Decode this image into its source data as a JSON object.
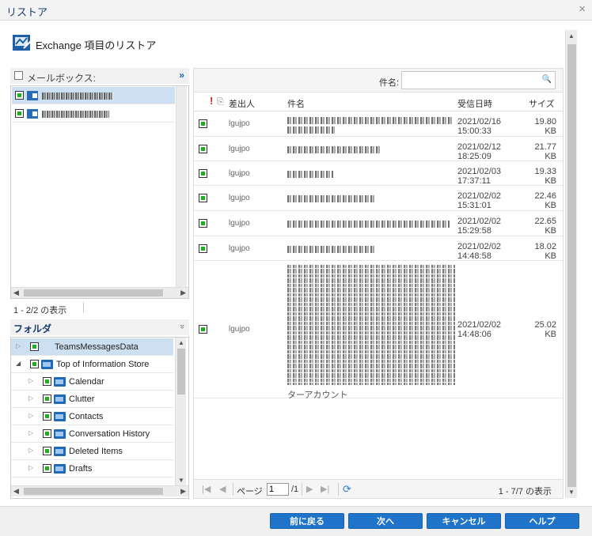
{
  "window": {
    "title": "リストア",
    "close_glyph": "×"
  },
  "heading": {
    "text": "Exchange 項目のリストア"
  },
  "mailbox_panel": {
    "header_label": "メールボックス:",
    "expand_glyph": "»",
    "count_text": "1 - 2/2 の表示",
    "items": [
      {
        "selected": true
      },
      {
        "selected": false
      }
    ]
  },
  "folder_panel": {
    "header_label": "フォルダ",
    "collapse_glyph": "»",
    "items": [
      {
        "label": "TeamsMessagesData",
        "selected": true
      },
      {
        "label": "Top of Information Store",
        "selected": false
      },
      {
        "label": "Calendar",
        "selected": false
      },
      {
        "label": "Clutter",
        "selected": false
      },
      {
        "label": "Contacts",
        "selected": false
      },
      {
        "label": "Conversation History",
        "selected": false
      },
      {
        "label": "Deleted Items",
        "selected": false
      },
      {
        "label": "Drafts",
        "selected": false
      }
    ]
  },
  "messages": {
    "search_label": "件名:",
    "search_value": "",
    "columns": {
      "importance": "!",
      "attachment": "⎘",
      "sender": "差出人",
      "subject": "件名",
      "received": "受信日時",
      "size": "サイズ"
    },
    "rows": [
      {
        "sender": "lgujpo",
        "received": "2021/02/16\n15:00:33",
        "size": "19.80\nKB"
      },
      {
        "sender": "lgujpo",
        "received": "2021/02/12\n18:25:09",
        "size": "21.77\nKB"
      },
      {
        "sender": "lgujpo",
        "received": "2021/02/03\n17:37:11",
        "size": "19.33\nKB"
      },
      {
        "sender": "lgujpo",
        "received": "2021/02/02\n15:31:01",
        "size": "22.46\nKB"
      },
      {
        "sender": "lgujpo",
        "received": "2021/02/02\n15:29:58",
        "size": "22.65\nKB"
      },
      {
        "sender": "lgujpo",
        "received": "2021/02/02\n14:48:58",
        "size": "18.02\nKB"
      },
      {
        "sender": "lgujpo",
        "received": "2021/02/02\n14:48:06",
        "size": "25.02\nKB",
        "subject_tail": "ターアカウント"
      }
    ],
    "pager": {
      "page_label": "ページ",
      "page_value": "1",
      "total_pages": "/1",
      "count_text": "1 - 7/7 の表示"
    }
  },
  "footer": {
    "back": "前に戻る",
    "next": "次へ",
    "cancel": "キャンセル",
    "help": "ヘルプ"
  },
  "colors": {
    "accent": "#1f74c9",
    "selection": "#cce0f2",
    "check_green": "#19b219"
  }
}
